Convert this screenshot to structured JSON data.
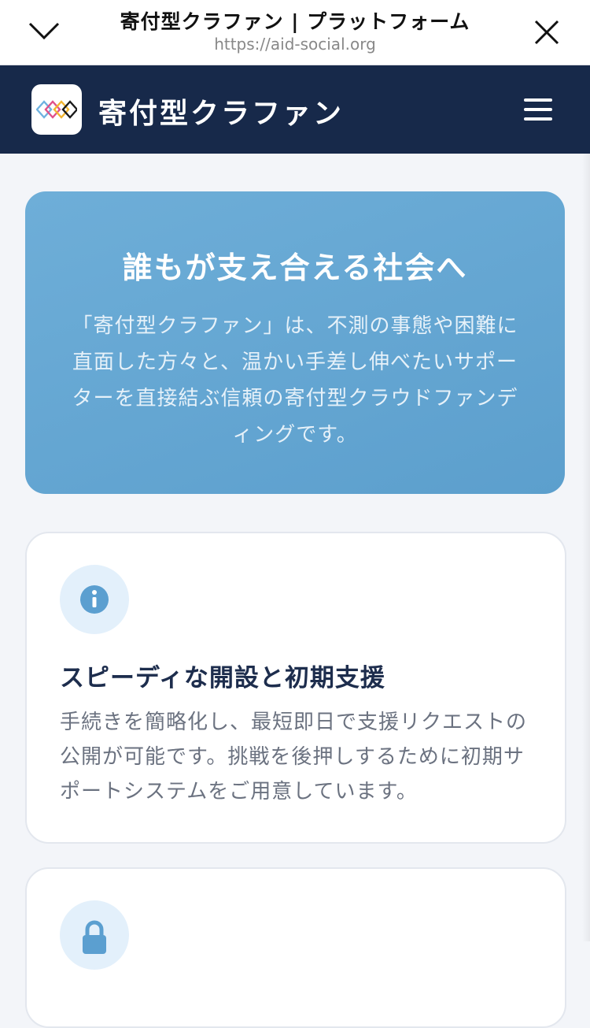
{
  "browser": {
    "title": "寄付型クラファン | プラットフォーム",
    "url": "https://aid-social.org"
  },
  "header": {
    "site_title": "寄付型クラファン",
    "logo_icon": "interlocked-diamonds-logo",
    "menu_icon": "hamburger-menu-icon"
  },
  "hero": {
    "heading": "誰もが支え合える社会へ",
    "body": "「寄付型クラファン」は、不測の事態や困難に直面した方々と、温かい手差し伸べたいサポーターを直接結ぶ信頼の寄付型クラウドファンディングです。"
  },
  "features": [
    {
      "icon": "info-icon",
      "title": "スピーディな開設と初期支援",
      "body": "手続きを簡略化し、最短即日で支援リクエストの公開が可能です。挑戦を後押しするために初期サポートシステムをご用意しています。"
    },
    {
      "icon": "lock-icon"
    }
  ],
  "colors": {
    "header_bg": "#17294a",
    "hero_bg": "#64a6d3",
    "accent": "#5b9fd0",
    "icon_bg": "#e3f0fb",
    "card_title": "#1d2d4d",
    "body_text": "#6b7280"
  }
}
